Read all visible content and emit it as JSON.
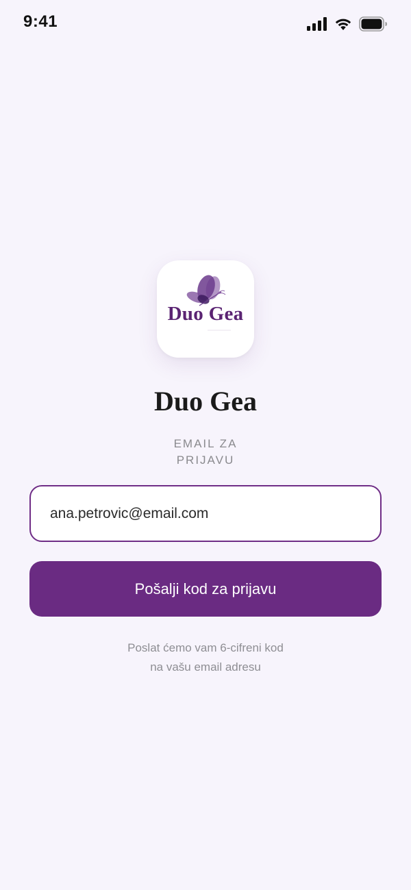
{
  "status_bar": {
    "time": "9:41",
    "icons": [
      "signal-icon",
      "wifi-icon",
      "battery-icon"
    ]
  },
  "app_icon": {
    "logo_text": "Duo Gea",
    "icon": "butterfly-icon"
  },
  "app_title": "Duo Gea",
  "login": {
    "email_label_line1": "EMAIL ZA",
    "email_label_line2": "PRIJAVU",
    "email_value": "ana.petrovic@email.com",
    "send_button_label": "Pošalji kod za prijavu",
    "helper_line1": "Poslat ćemo vam 6-cifreni kod",
    "helper_line2": "na vašu email adresu"
  },
  "colors": {
    "background": "#f7f4fc",
    "accent": "#6a2b82",
    "logo": "#5a2372",
    "muted_text": "#8e8e93"
  }
}
